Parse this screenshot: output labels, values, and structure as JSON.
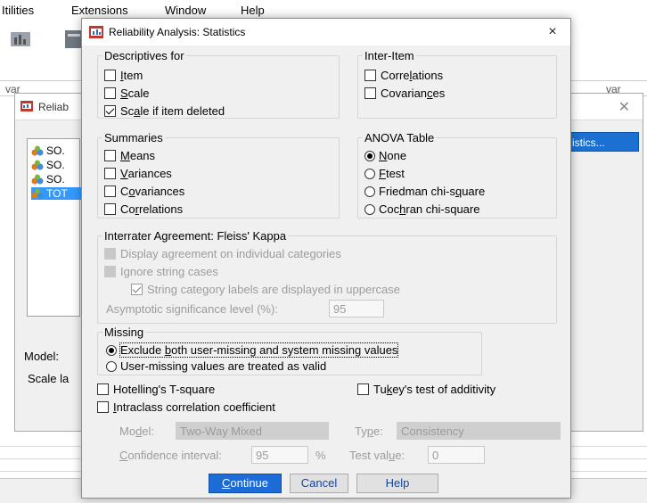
{
  "background": {
    "menu": [
      "Itilities",
      "Extensions",
      "Window",
      "Help"
    ],
    "var_headers": [
      "var",
      "var"
    ],
    "dialog_title": "Reliab",
    "variables": [
      {
        "label": "SO.",
        "selected": false
      },
      {
        "label": "SO.",
        "selected": false
      },
      {
        "label": "SO.",
        "selected": false
      },
      {
        "label": "TOT",
        "selected": true
      }
    ],
    "statistics_button": "istics...",
    "model_label": "Model:",
    "scale_label": "Scale la"
  },
  "dialog": {
    "title": "Reliability Analysis: Statistics",
    "close": "×"
  },
  "descriptives": {
    "legend": "Descriptives for",
    "item": {
      "pre": "",
      "key": "I",
      "post": "tem",
      "checked": false
    },
    "scale": {
      "pre": "",
      "key": "S",
      "post": "cale",
      "checked": false
    },
    "scale_if_deleted": {
      "pre": "Sc",
      "key": "a",
      "post": "le if item deleted",
      "checked": true
    }
  },
  "inter_item": {
    "legend": "Inter-Item",
    "correlations": {
      "pre": "Corre",
      "key": "l",
      "post": "ations",
      "checked": false
    },
    "covariances": {
      "pre": "Covarian",
      "key": "c",
      "post": "es",
      "checked": false
    }
  },
  "summaries": {
    "legend": "Summaries",
    "means": {
      "pre": "",
      "key": "M",
      "post": "eans",
      "checked": false
    },
    "variances": {
      "pre": "",
      "key": "V",
      "post": "ariances",
      "checked": false
    },
    "covariances": {
      "pre": "C",
      "key": "o",
      "post": "variances",
      "checked": false
    },
    "correlations": {
      "pre": "Co",
      "key": "r",
      "post": "relations",
      "checked": false
    }
  },
  "anova": {
    "legend": "ANOVA Table",
    "none": {
      "pre": "",
      "key": "N",
      "post": "one",
      "selected": true
    },
    "ftest": {
      "pre": "",
      "key": "F",
      "post": " test",
      "selected": false
    },
    "friedman": {
      "pre": "Friedman chi-s",
      "key": "q",
      "post": "uare",
      "selected": false
    },
    "cochran": {
      "pre": "Coc",
      "key": "h",
      "post": "ran chi-square",
      "selected": false
    }
  },
  "interrater": {
    "legend": "Interrater Agreement: Fleiss' Kappa",
    "display_individual": "Display agreement on individual categories",
    "ignore_case": "Ignore string cases",
    "uppercase": "String category labels are displayed in uppercase",
    "asymptotic_label": "Asymptotic significance level (%):",
    "asymptotic_value": "95"
  },
  "missing": {
    "legend": "Missing",
    "exclude": {
      "pre": "Exclude ",
      "key": "b",
      "post": "oth user-missing and system missing values",
      "selected": true
    },
    "valid": {
      "pre": "User-missing values are treated as valid",
      "key": "",
      "post": "",
      "selected": false
    }
  },
  "extra": {
    "hotelling": {
      "pre": "Hotellin",
      "key": "g",
      "post": "'s T-square",
      "checked": false
    },
    "tukey": {
      "pre": "Tu",
      "key": "k",
      "post": "ey's test of additivity",
      "checked": false
    },
    "icc": {
      "pre": "",
      "key": "I",
      "post": "ntraclass correlation coefficient",
      "checked": false
    }
  },
  "icc_options": {
    "model_label": {
      "pre": "Mo",
      "key": "d",
      "post": "el:"
    },
    "model_value": "Two-Way Mixed",
    "type_label": {
      "pre": "Ty",
      "key": "p",
      "post": "e:"
    },
    "type_value": "Consistency",
    "ci_label": {
      "pre": "",
      "key": "C",
      "post": "onfidence interval:"
    },
    "ci_value": "95",
    "ci_unit": "%",
    "test_label": {
      "pre": "Test val",
      "key": "u",
      "post": "e:"
    },
    "test_value": "0"
  },
  "buttons": {
    "continue": {
      "pre": "",
      "key": "C",
      "post": "ontinue"
    },
    "cancel": "Cancel",
    "help": "Help"
  },
  "colors": {
    "primary_button": "#1c6bd6",
    "dialog_bg": "#f0f0f0",
    "selection": "#3399ff"
  }
}
